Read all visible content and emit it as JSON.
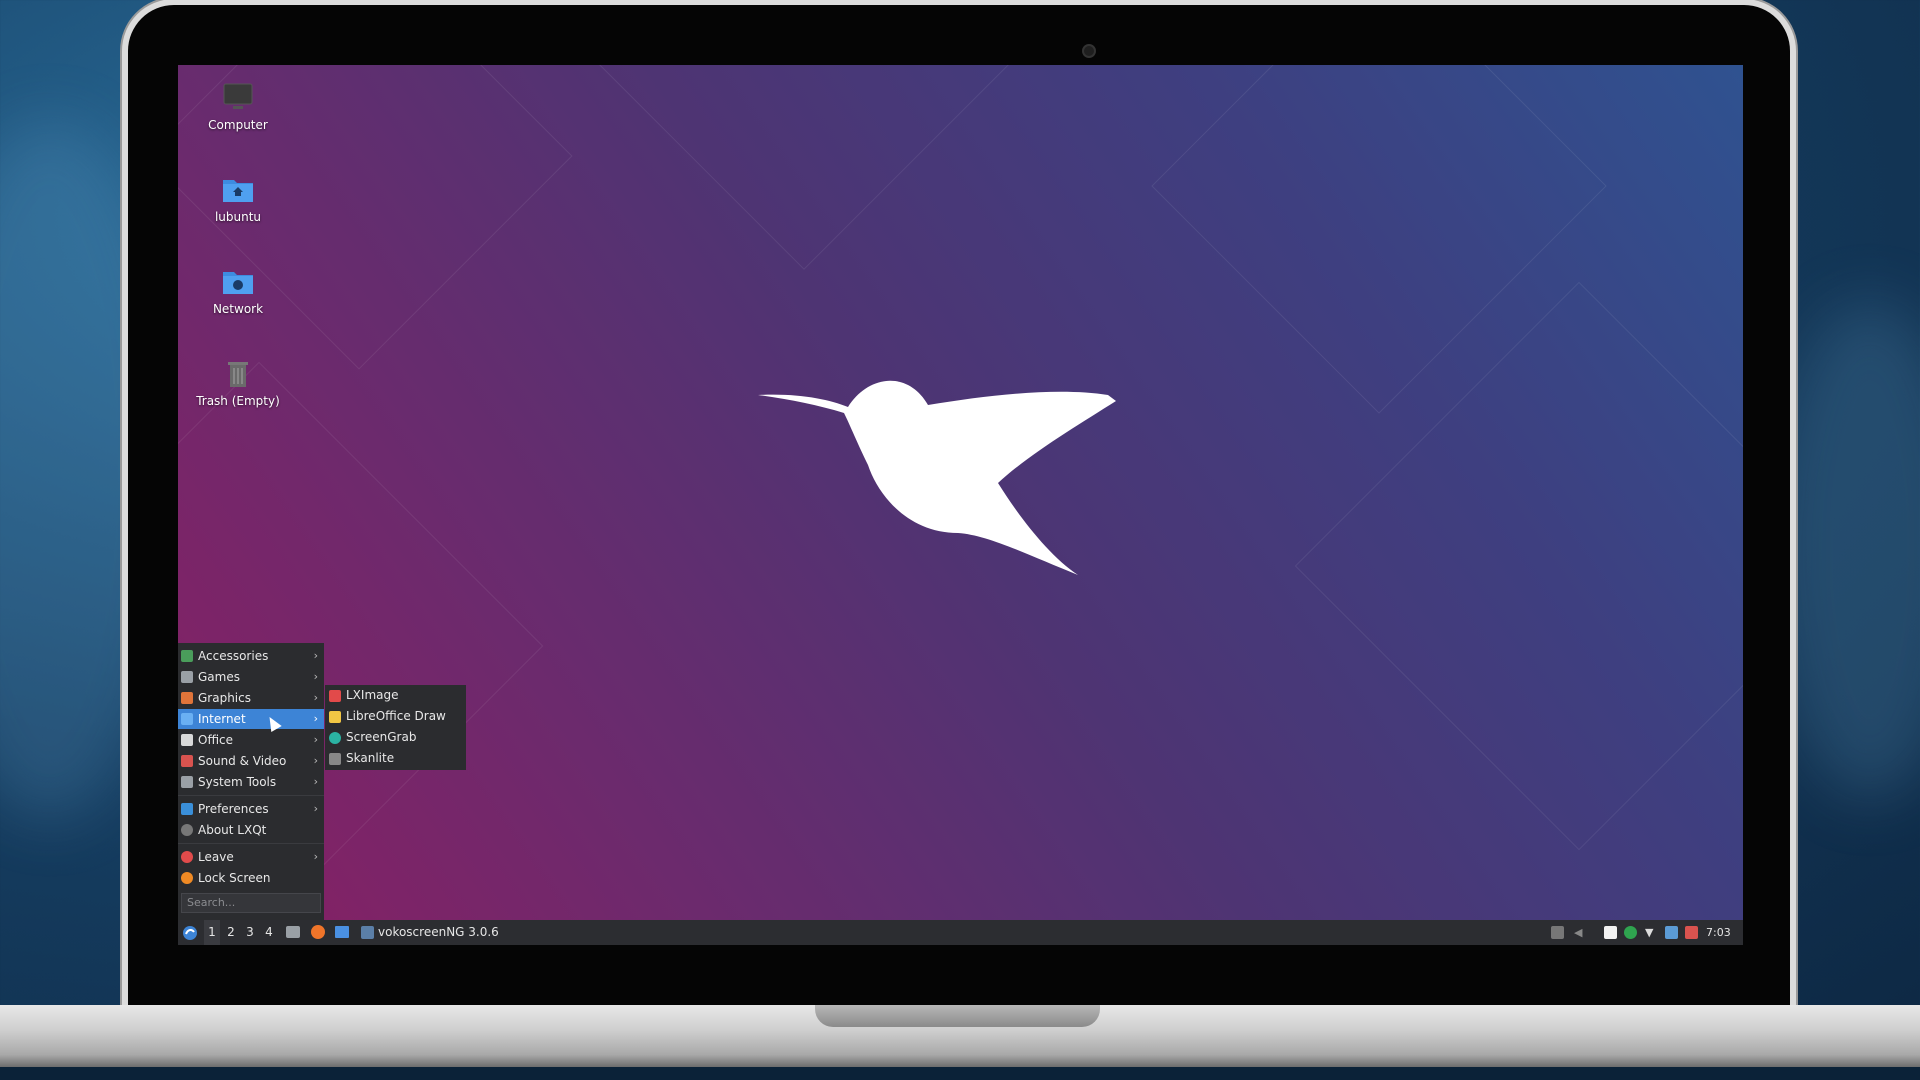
{
  "desktop": {
    "icons": [
      {
        "label": "Computer"
      },
      {
        "label": "lubuntu"
      },
      {
        "label": "Network"
      },
      {
        "label": "Trash (Empty)"
      }
    ]
  },
  "app_menu": {
    "items": [
      {
        "label": "Accessories",
        "icon": "accessories-icon",
        "color": "#4a9d5b",
        "submenu": true
      },
      {
        "label": "Games",
        "icon": "games-icon",
        "color": "#9aa0a6",
        "submenu": true
      },
      {
        "label": "Graphics",
        "icon": "graphics-icon",
        "color": "#e0743a",
        "submenu": true
      },
      {
        "label": "Internet",
        "icon": "internet-icon",
        "color": "#6ab0f3",
        "submenu": true,
        "active": true
      },
      {
        "label": "Office",
        "icon": "office-icon",
        "color": "#d9d9d9",
        "submenu": true
      },
      {
        "label": "Sound & Video",
        "icon": "sound-video-icon",
        "color": "#d9534f",
        "submenu": true
      },
      {
        "label": "System Tools",
        "icon": "system-tools-icon",
        "color": "#9aa0a6",
        "submenu": true
      },
      {
        "label": "Preferences",
        "icon": "preferences-icon",
        "color": "#3a8fd9",
        "submenu": true
      },
      {
        "label": "About LXQt",
        "icon": "info-icon",
        "color": "#777",
        "submenu": false
      },
      {
        "label": "Leave",
        "icon": "power-icon",
        "color": "#e14b4b",
        "submenu": true
      },
      {
        "label": "Lock Screen",
        "icon": "lock-icon",
        "color": "#f08a24",
        "submenu": false
      }
    ],
    "search_placeholder": "Search...",
    "submenu_internet": [
      {
        "label": "LXImage",
        "icon": "lximage-icon",
        "color": "#e24a4a"
      },
      {
        "label": "LibreOffice Draw",
        "icon": "libreoffice-draw-icon",
        "color": "#f2c744"
      },
      {
        "label": "ScreenGrab",
        "icon": "screengrab-icon",
        "color": "#2bb3a3"
      },
      {
        "label": "Skanlite",
        "icon": "skanlite-icon",
        "color": "#888"
      }
    ]
  },
  "taskbar": {
    "workspaces": [
      "1",
      "2",
      "3",
      "4"
    ],
    "active_workspace": "1",
    "window_title": "vokoscreenNG 3.0.6",
    "clock": "7:03"
  },
  "colors": {
    "accent": "#3d84d6",
    "menu_bg": "#2b2c2f",
    "taskbar_bg": "#2c2d31"
  }
}
